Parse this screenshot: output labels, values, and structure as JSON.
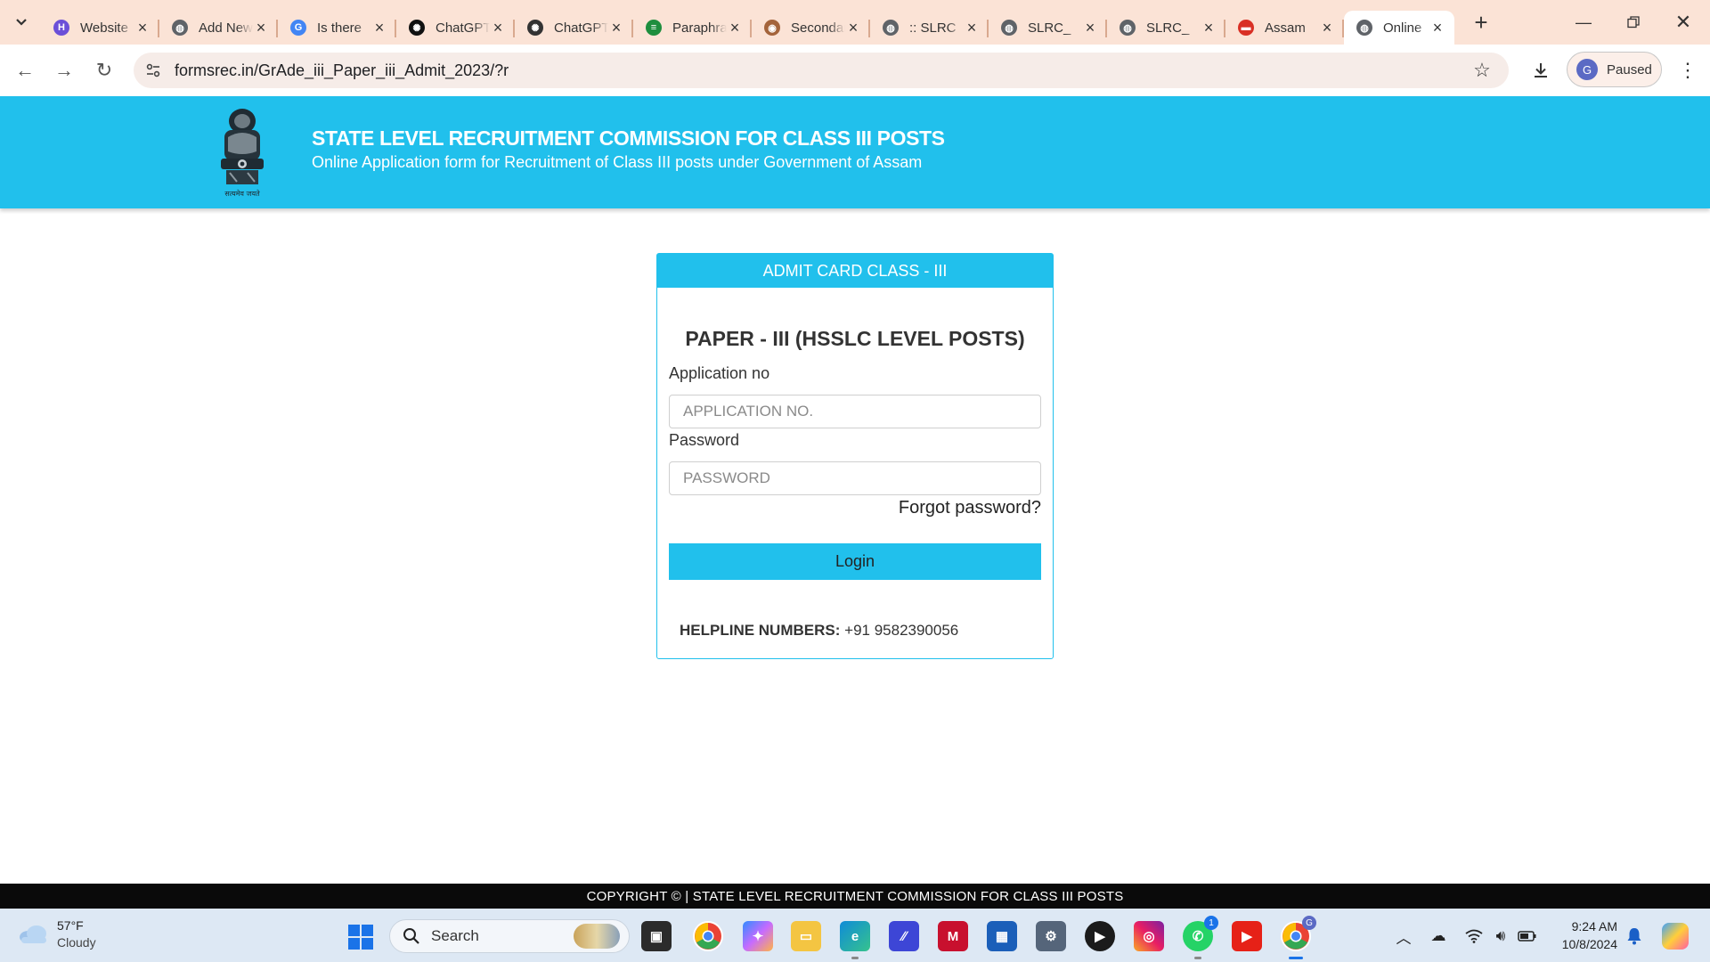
{
  "browser": {
    "tabs": [
      {
        "title": "Website",
        "favicon_color": "#6b4fd8",
        "favicon_glyph": "H"
      },
      {
        "title": "Add New",
        "favicon_color": "#5f6368",
        "favicon_glyph": "◍"
      },
      {
        "title": "Is there",
        "favicon_color": "#4285f4",
        "favicon_glyph": "G"
      },
      {
        "title": "ChatGPT",
        "favicon_color": "#111111",
        "favicon_glyph": "✺"
      },
      {
        "title": "ChatGPT",
        "favicon_color": "#333333",
        "favicon_glyph": "✺"
      },
      {
        "title": "Paraphrase",
        "favicon_color": "#1e8e3e",
        "favicon_glyph": "≡"
      },
      {
        "title": "Secondary",
        "favicon_color": "#a4643b",
        "favicon_glyph": "◉"
      },
      {
        "title": ":: SLRC",
        "favicon_color": "#5f6368",
        "favicon_glyph": "◍"
      },
      {
        "title": "SLRC_",
        "favicon_color": "#5f6368",
        "favicon_glyph": "◍"
      },
      {
        "title": "SLRC_",
        "favicon_color": "#5f6368",
        "favicon_glyph": "◍"
      },
      {
        "title": "Assam",
        "favicon_color": "#d93025",
        "favicon_glyph": "▬"
      },
      {
        "title": "Online",
        "favicon_color": "#5f6368",
        "favicon_glyph": "◍",
        "active": true
      }
    ],
    "url": "formsrec.in/GrAde_iii_Paper_iii_Admit_2023/?r",
    "profile_initial": "G",
    "profile_status": "Paused"
  },
  "header": {
    "title": "STATE LEVEL RECRUITMENT COMMISSION FOR CLASS III POSTS",
    "subtitle": "Online Application form for Recruitment of Class III posts under Government of Assam",
    "emblem_caption": "सत्यमेव जयते"
  },
  "card": {
    "heading": "ADMIT CARD CLASS - III",
    "title": "PAPER - III (HSSLC LEVEL POSTS)",
    "application_label": "Application no",
    "application_placeholder": "APPLICATION NO.",
    "password_label": "Password",
    "password_placeholder": "PASSWORD",
    "forgot_text": "Forgot password?",
    "login_label": "Login",
    "helpline_label": "HELPLINE NUMBERS:",
    "helpline_number": "+91 9582390056"
  },
  "footer": {
    "copyright": "COPYRIGHT © | STATE LEVEL RECRUITMENT COMMISSION FOR CLASS III POSTS"
  },
  "taskbar": {
    "weather_temp": "57°F",
    "weather_desc": "Cloudy",
    "search_label": "Search",
    "whatsapp_badge": "1",
    "chrome_badge": "G",
    "time": "9:24 AM",
    "date": "10/8/2024"
  },
  "colors": {
    "brand": "#21c0ec",
    "footer_bg": "#0a0a0a",
    "tabstrip_bg": "#fbe3d6"
  }
}
